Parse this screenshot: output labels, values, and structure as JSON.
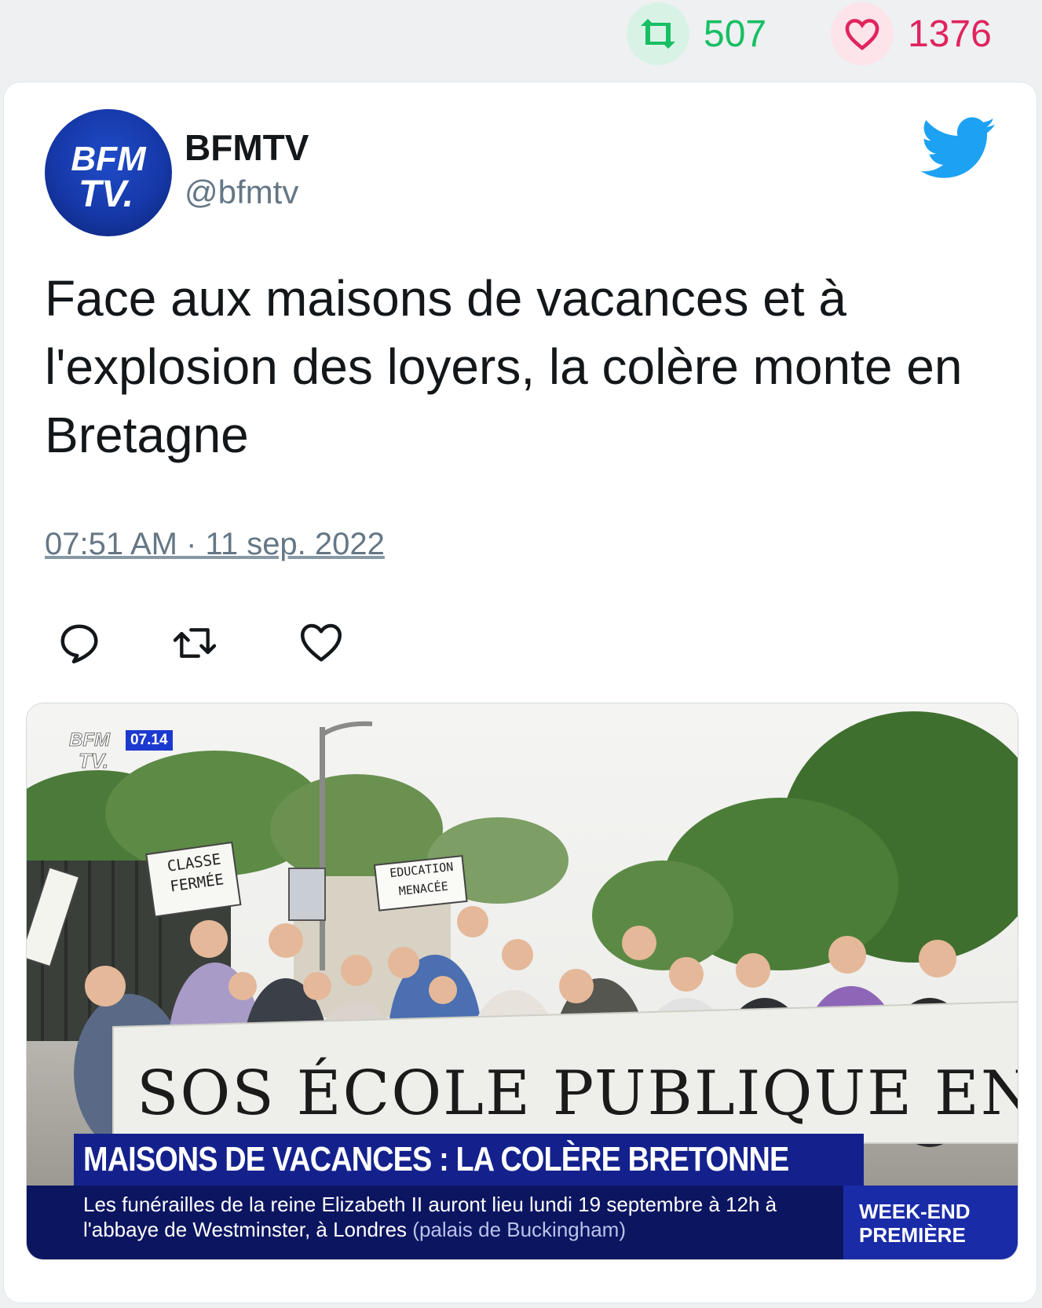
{
  "stats": {
    "retweet_count": "507",
    "like_count": "1376"
  },
  "tweet": {
    "author_name": "BFMTV",
    "author_handle": "@bfmtv",
    "text": "Face aux maisons de vacances et à l'explosion des loyers, la colère monte en Bretagne",
    "timestamp": "07:51 AM · 11 sep. 2022",
    "avatar_text_line1": "BFM",
    "avatar_text_line2": "TV."
  },
  "media": {
    "channel_logo_line1": "BFM",
    "channel_logo_line2": "TV.",
    "clock": "07.14",
    "headline": "MAISONS DE VACANCES : LA COLÈRE BRETONNE",
    "ticker_text": "Les funérailles de la reine Elizabeth II auront lieu lundi 19 septembre à 12h à l'abbaye de Westminster, à Londres",
    "ticker_source": "(palais de Buckingham)",
    "show_line1": "WEEK-END",
    "show_line2": "PREMIÈRE",
    "sign_classe": "CLASSE FERMÉE",
    "sign_education": "EDUCATION MENACÉE",
    "banner": "SOS ÉCOLE PUBLIQUE EN DANGER"
  },
  "icons": {
    "retweet": "retweet-icon",
    "like": "heart-icon",
    "reply": "reply-icon",
    "brand": "twitter-bird-icon"
  },
  "colors": {
    "retweet_green": "#17bf63",
    "like_pink": "#e0245e",
    "twitter_blue": "#1da1f2",
    "text_primary": "#14171a",
    "text_secondary": "#657786",
    "bfm_blue": "#14218d"
  }
}
